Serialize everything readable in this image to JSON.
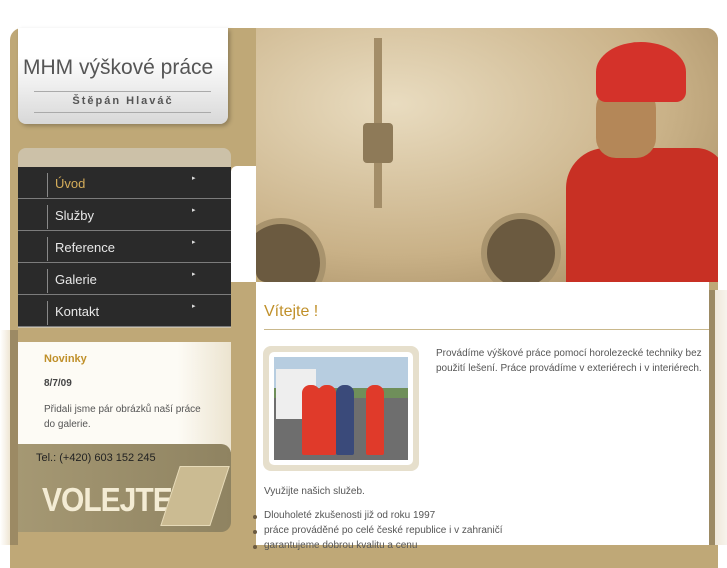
{
  "header": {
    "title": "MHM výškové práce",
    "subtitle": "Štěpán Hlaváč"
  },
  "menu": [
    {
      "label": "Úvod",
      "active": true
    },
    {
      "label": "Služby"
    },
    {
      "label": "Reference"
    },
    {
      "label": "Galerie"
    },
    {
      "label": "Kontakt"
    }
  ],
  "menu_arrow": "▸",
  "news": {
    "heading": "Novinky",
    "date": "8/7/09",
    "text": "Přidali jsme pár obrázků naší práce do galerie."
  },
  "contact": {
    "phone": "Tel.: (+420) 603 152 245",
    "banner": "VOLEJTE"
  },
  "main": {
    "heading": "Vítejte !",
    "intro": "Provádíme výškové práce pomocí horolezecké techniky bez použití lešení. Práce provádíme v exteriérech i v interiérech.",
    "use": "Využijte našich služeb.",
    "bullets": [
      "Dlouholeté zkušenosti již od roku 1997",
      "práce prováděné po celé české republice i v zahraničí",
      "garantujeme dobrou kvalitu a cenu"
    ]
  }
}
